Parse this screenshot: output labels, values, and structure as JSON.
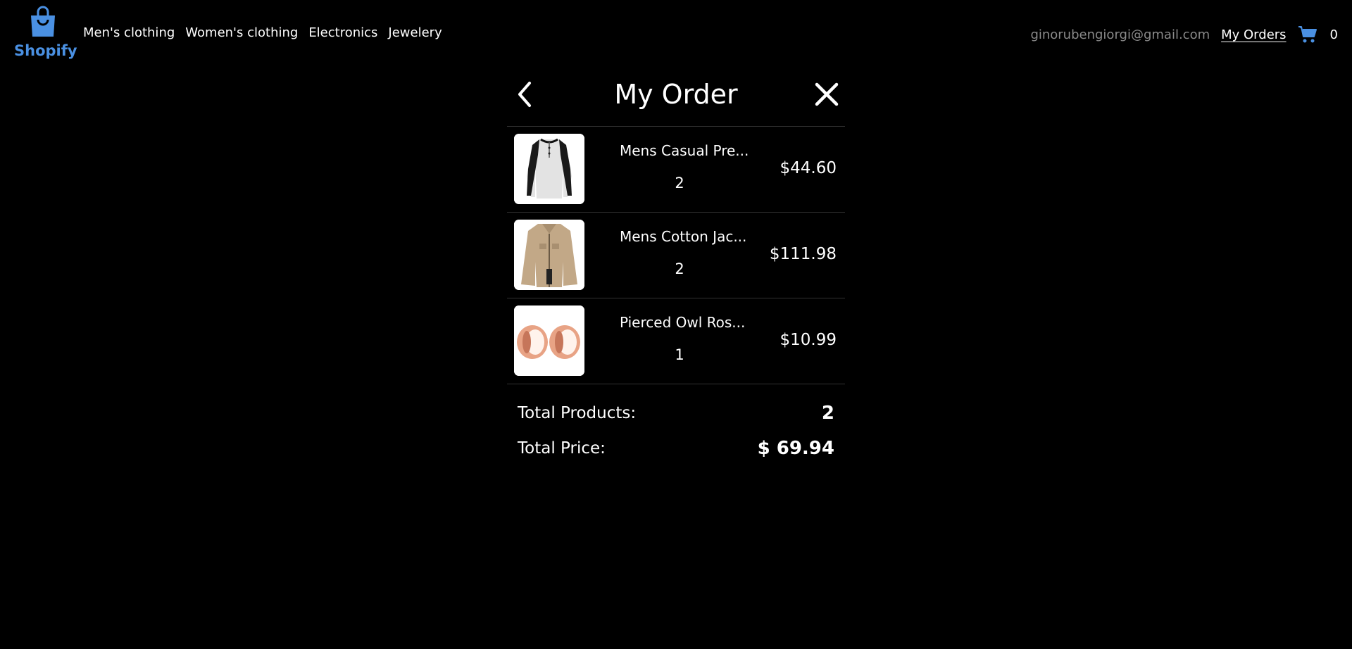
{
  "brand": {
    "name": "Shopify",
    "color": "#4a90e2"
  },
  "nav": [
    {
      "label": "Men's clothing"
    },
    {
      "label": "Women's clothing"
    },
    {
      "label": "Electronics"
    },
    {
      "label": "Jewelery"
    }
  ],
  "account": {
    "email": "ginorubengiorgi@gmail.com",
    "orders_label": "My Orders",
    "cart_count": "0"
  },
  "order": {
    "title": "My Order",
    "items": [
      {
        "name": "Mens Casual Pre...",
        "quantity": "2",
        "price": "$44.60",
        "image": "shirt-image"
      },
      {
        "name": "Mens Cotton Jac...",
        "quantity": "2",
        "price": "$111.98",
        "image": "jacket-image"
      },
      {
        "name": "Pierced Owl Ros...",
        "quantity": "1",
        "price": "$10.99",
        "image": "earrings-image"
      }
    ],
    "totals": {
      "products_label": "Total Products:",
      "products_value": "2",
      "price_label": "Total Price:",
      "price_value": "$ 69.94"
    }
  }
}
